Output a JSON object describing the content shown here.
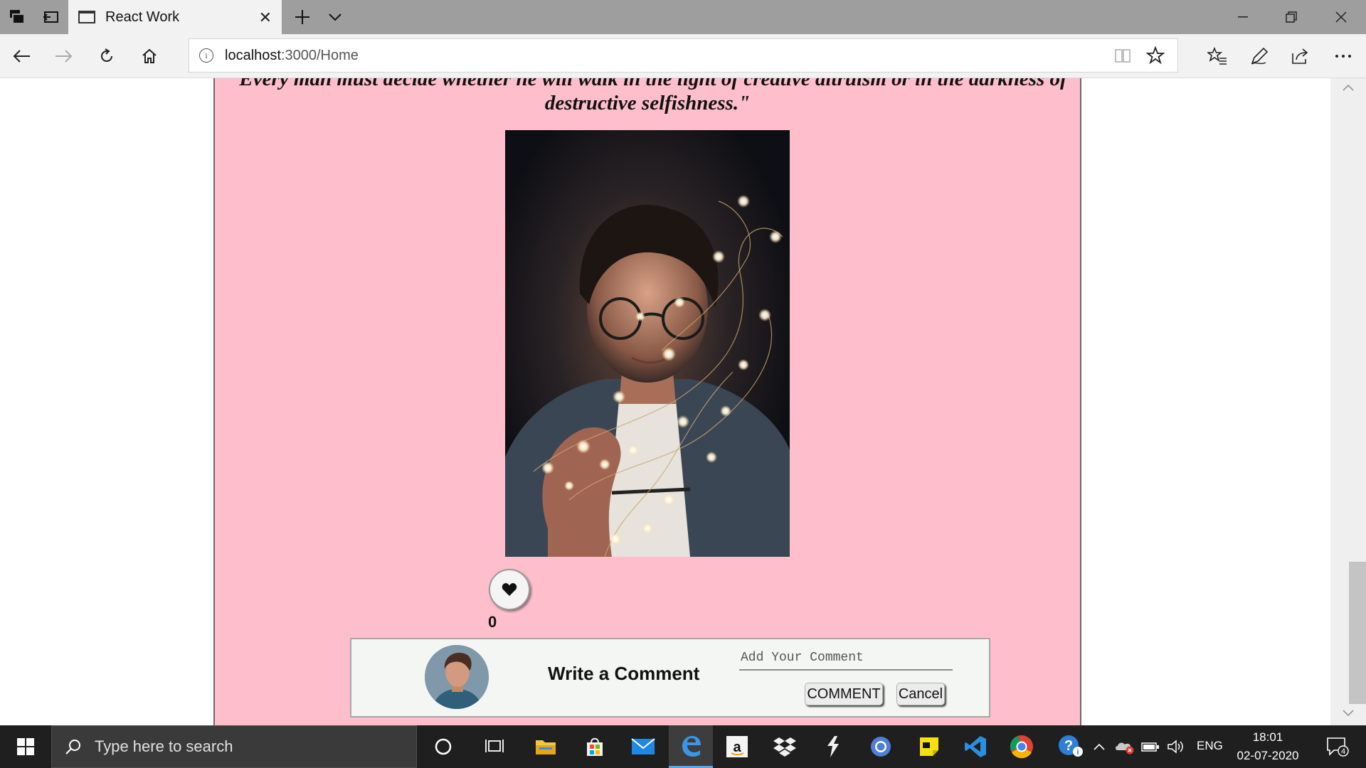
{
  "browser": {
    "tab_title": "React Work",
    "url_host": "localhost",
    "url_rest": ":3000/Home"
  },
  "post": {
    "quote": "\"Every man must decide whether he will walk in the light of creative altruism or in the darkness of destructive selfishness.\"",
    "like_count": "0"
  },
  "comment": {
    "label": "Write a Comment",
    "placeholder": "Add Your Comment",
    "submit_label": "COMMENT",
    "cancel_label": "Cancel"
  },
  "taskbar": {
    "search_placeholder": "Type here to search",
    "language": "ENG",
    "time": "18:01",
    "date": "02-07-2020",
    "notification_count": "4"
  },
  "colors": {
    "page_background": "#ffbecb",
    "comment_box": "#f4f6f4",
    "taskbar": "#1f1f1f"
  }
}
